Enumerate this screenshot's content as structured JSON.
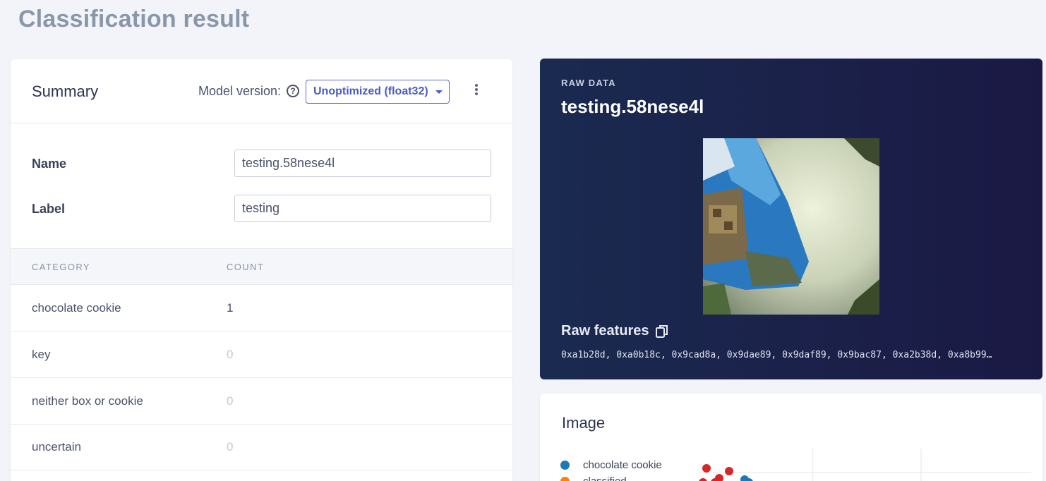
{
  "page": {
    "title": "Classification result"
  },
  "summary": {
    "title": "Summary",
    "model_version_label": "Model version:",
    "model_version_value": "Unoptimized (float32)",
    "fields": [
      {
        "label": "Name",
        "value": "testing.58nese4l"
      },
      {
        "label": "Label",
        "value": "testing"
      }
    ],
    "table": {
      "headers": [
        "CATEGORY",
        "COUNT"
      ],
      "rows": [
        {
          "category": "chocolate cookie",
          "count": "1"
        },
        {
          "category": "key",
          "count": "0"
        },
        {
          "category": "neither box or cookie",
          "count": "0"
        },
        {
          "category": "uncertain",
          "count": "0"
        }
      ]
    }
  },
  "raw_data": {
    "kicker": "RAW DATA",
    "sample_name": "testing.58nese4l",
    "raw_features_label": "Raw features",
    "raw_features_values": "0xa1b28d, 0xa0b18c, 0x9cad8a, 0x9dae89, 0x9daf89, 0x9bac87, 0xa2b38d, 0xa8b99…"
  },
  "image_panel": {
    "title": "Image",
    "legend": [
      {
        "name": "chocolate cookie",
        "color": "#1f77b4"
      },
      {
        "name": "classified",
        "color": "#ff7f0e"
      }
    ]
  },
  "colors": {
    "accent": "#4b5bc4",
    "count_nonzero": "#4a536b",
    "count_zero": "#c3c8d3",
    "scatter_red": "#d62728",
    "scatter_blue": "#1f77b4"
  }
}
